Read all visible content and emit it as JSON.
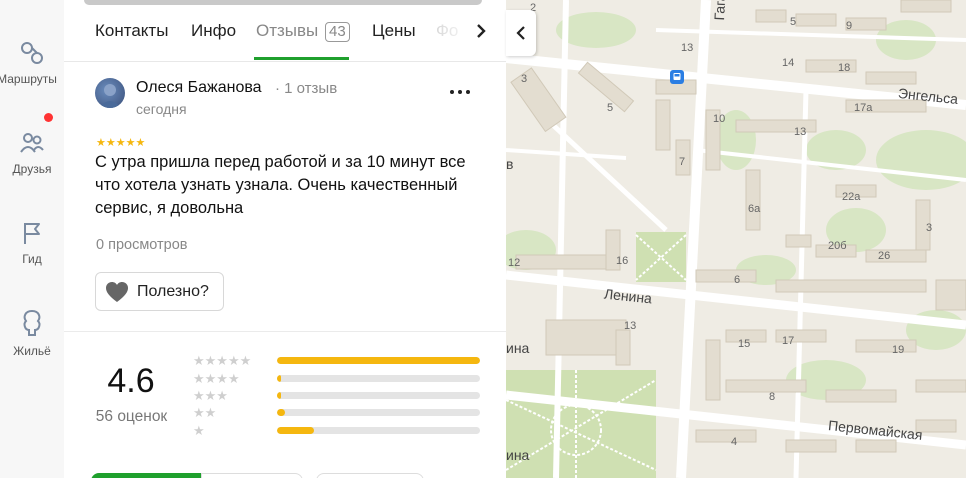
{
  "rail": {
    "items": [
      {
        "label": "Маршруты",
        "icon": "route-icon"
      },
      {
        "label": "Друзья",
        "icon": "friends-icon"
      },
      {
        "label": "Гид",
        "icon": "flag-icon"
      },
      {
        "label": "Жильё",
        "icon": "housing-icon"
      }
    ]
  },
  "tabs": {
    "items": [
      {
        "label": "Контакты"
      },
      {
        "label": "Инфо"
      },
      {
        "label": "Отзывы",
        "count": "43"
      },
      {
        "label": "Цены"
      },
      {
        "label": "Фо"
      }
    ],
    "active": "Отзывы"
  },
  "review": {
    "author": "Олеся Бажанова",
    "author_meta": "· 1 отзыв",
    "date": "сегодня",
    "stars": "★★★★★",
    "text": "С утра пришла перед работой и за 10 минут все что хотела узнать узнала. Очень качественный сервис, я довольна",
    "views": "0 просмотров",
    "helpful_label": "Полезно?"
  },
  "rating": {
    "value": "4.6",
    "count_label": "56 оценок",
    "distribution": [
      {
        "stars": "★★★★★",
        "fraction": 1.0
      },
      {
        "stars": "★★★★",
        "fraction": 0.02
      },
      {
        "stars": "★★★",
        "fraction": 0.02
      },
      {
        "stars": "★★",
        "fraction": 0.04
      },
      {
        "stars": "★",
        "fraction": 0.18
      }
    ]
  },
  "map": {
    "streets": [
      "Гагарина",
      "Энгельса",
      "Ленина",
      "Первомайская",
      "ина",
      "ина",
      "в"
    ],
    "house_numbers": [
      "2",
      "5",
      "9",
      "13",
      "14",
      "18",
      "3",
      "5",
      "17а",
      "10",
      "13",
      "7",
      "6а",
      "22а",
      "3",
      "20б",
      "26",
      "16",
      "12",
      "6",
      "13",
      "15",
      "17",
      "19",
      "8",
      "4"
    ]
  },
  "colors": {
    "accent_green": "#1fa02d",
    "star_yellow": "#f5b70f",
    "notification_red": "#ff3333",
    "bus_blue": "#2b7ee3"
  }
}
